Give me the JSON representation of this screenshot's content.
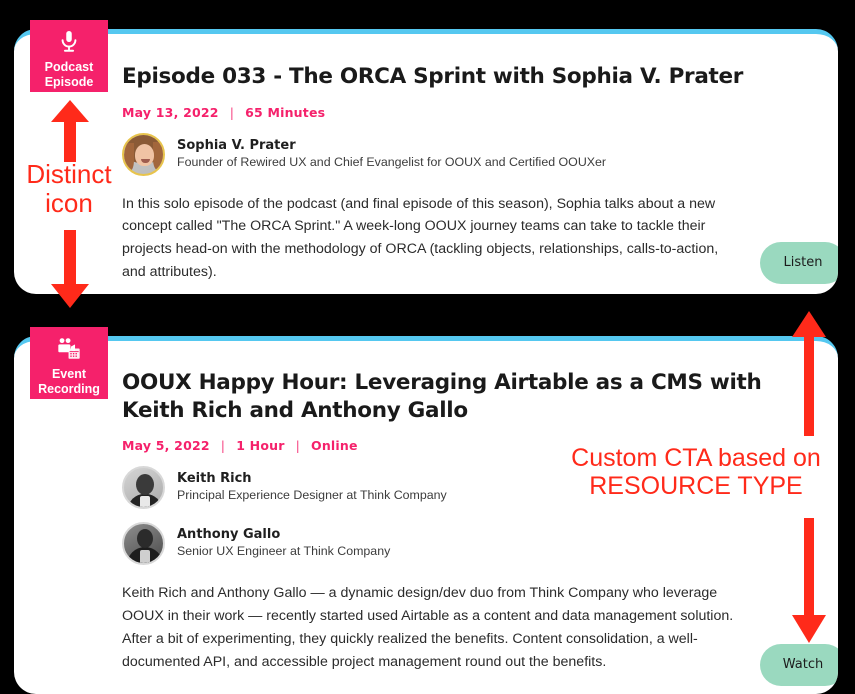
{
  "theme": {
    "page_background": "#000000",
    "card_background": "#ffffff",
    "card_top_border": "#55c8f0",
    "badge_pink": "#f5216b",
    "meta_pink": "#f5216b",
    "cta_green": "#9ad9bf",
    "annotation_red": "#ff2a1a"
  },
  "cards": [
    {
      "type_badge": {
        "icon": "microphone-icon",
        "label_line1": "Podcast",
        "label_line2": "Episode"
      },
      "title": "Episode 033 - The ORCA Sprint with Sophia V. Prater",
      "meta": [
        "May 13, 2022",
        "65 Minutes"
      ],
      "people": [
        {
          "avatar": "avatar-sophia-prater",
          "name": "Sophia V. Prater",
          "role": "Founder of Rewired UX and Chief Evangelist for OOUX and Certified OOUXer"
        }
      ],
      "description": "In this solo episode of the podcast (and final episode of this season), Sophia talks about a new concept called \"The ORCA Sprint.\" A week-long OOUX journey teams can take to tackle their projects head-on with the methodology of ORCA (tackling objects, relationships, calls-to-action, and attributes).",
      "cta_label": "Listen"
    },
    {
      "type_badge": {
        "icon": "video-camera-calendar-icon",
        "label_line1": "Event",
        "label_line2": "Recording"
      },
      "title": "OOUX Happy Hour: Leveraging Airtable as a CMS with Keith Rich and Anthony Gallo",
      "meta": [
        "May 5, 2022",
        "1 Hour",
        "Online"
      ],
      "people": [
        {
          "avatar": "avatar-keith-rich",
          "name": "Keith Rich",
          "role": "Principal Experience Designer at Think Company"
        },
        {
          "avatar": "avatar-anthony-gallo",
          "name": "Anthony Gallo",
          "role": "Senior UX Engineer at Think Company"
        }
      ],
      "description": "Keith Rich and Anthony Gallo — a dynamic design/dev duo from Think Company who leverage OOUX in their work — recently started used Airtable as a content and data management solution. After a bit of experimenting, they quickly realized the benefits. Content consolidation, a well-documented API, and accessible project management round out the benefits.",
      "cta_label": "Watch"
    }
  ],
  "annotations": [
    {
      "id": "distinct-icon",
      "line1": "Distinct",
      "line2": "icon",
      "arrow_up": "arrow-up-to-podcast-badge",
      "arrow_down": "arrow-down-to-event-badge"
    },
    {
      "id": "custom-cta",
      "line1": "Custom CTA based on",
      "line2": "RESOURCE TYPE",
      "arrow_up": "arrow-up-to-listen-button",
      "arrow_down": "arrow-down-to-watch-button"
    }
  ]
}
